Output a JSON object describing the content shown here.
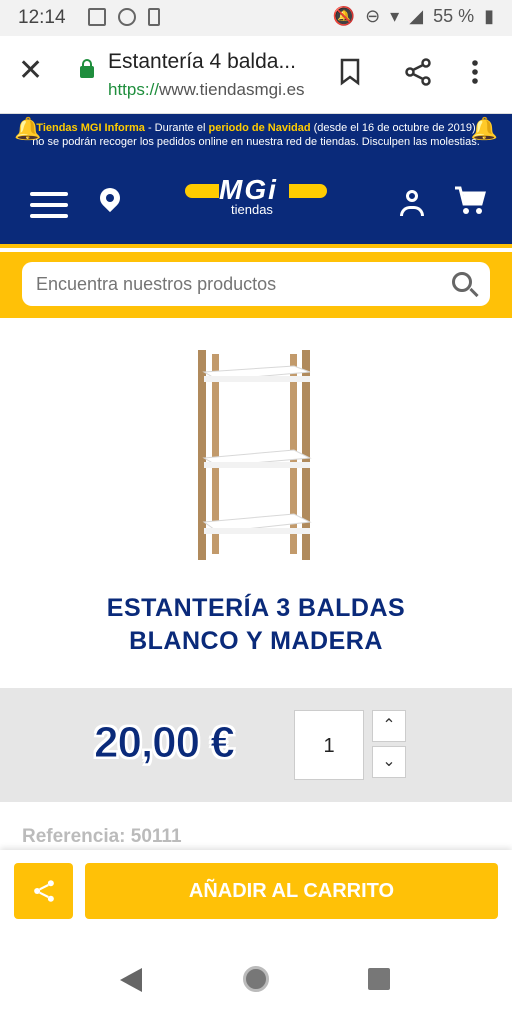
{
  "status_bar": {
    "time": "12:14",
    "battery": "55 %"
  },
  "browser": {
    "page_title": "Estantería 4 balda...",
    "url_scheme": "https://",
    "url_host": "www.tiendasmgi.es"
  },
  "banner": {
    "brand": "Tiendas MGI Informa",
    "text_a": " - Durante el ",
    "highlight": "periodo de Navidad",
    "text_b": " (desde el 16 de octubre de 2019)",
    "line2": "no se podrán recoger los pedidos online en nuestra red de tiendas. Disculpen las molestias."
  },
  "header": {
    "logo_text": "MGi",
    "logo_sub": "tiendas"
  },
  "search": {
    "placeholder": "Encuentra nuestros productos"
  },
  "product": {
    "title_line1": "ESTANTERÍA 3 BALDAS",
    "title_line2": "BLANCO Y MADERA",
    "price": "20,00 €",
    "quantity": "1",
    "reference": "Referencia: 50111"
  },
  "actions": {
    "add_to_cart": "AÑADIR AL CARRITO"
  },
  "colors": {
    "brand_blue": "#0a2a7a",
    "brand_yellow": "#ffc107",
    "secure_green": "#1f8e3d"
  },
  "icons": [
    "close-icon",
    "lock-icon",
    "bookmark-icon",
    "share-icon",
    "more-icon",
    "menu-icon",
    "location-icon",
    "user-icon",
    "cart-icon",
    "search-icon",
    "chevron-up-icon",
    "chevron-down-icon",
    "back-icon",
    "home-icon",
    "recents-icon"
  ]
}
